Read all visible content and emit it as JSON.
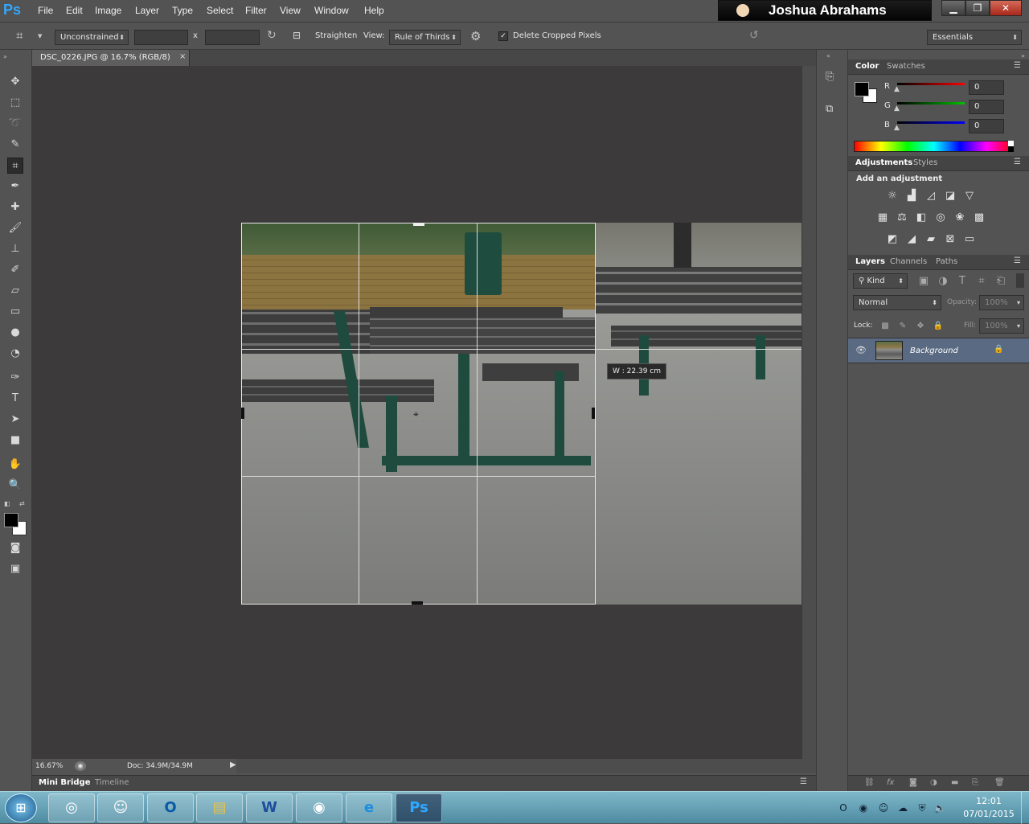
{
  "app": {
    "logo": "Ps"
  },
  "menu": [
    "File",
    "Edit",
    "Image",
    "Layer",
    "Type",
    "Select",
    "Filter",
    "View",
    "Window",
    "Help"
  ],
  "user": {
    "name": "Joshua Abrahams"
  },
  "window_controls": {
    "minimize": "▁",
    "restore": "❐",
    "close": "✕"
  },
  "options": {
    "ratio": "Unconstrained",
    "times": "x",
    "straighten": "Straighten",
    "view_label": "View:",
    "view_value": "Rule of Thirds",
    "delete_cropped": "Delete Cropped Pixels",
    "workspace": "Essentials"
  },
  "document": {
    "tab": "DSC_0226.JPG @ 16.7% (RGB/8)",
    "close": "×"
  },
  "crop_readout": "W :  22.39 cm",
  "status": {
    "zoom": "16.67%",
    "doc": "Doc: 34.9M/34.9M"
  },
  "bottom_tabs": [
    "Mini Bridge",
    "Timeline"
  ],
  "color_panel": {
    "tabs": [
      "Color",
      "Swatches"
    ],
    "channels": [
      {
        "label": "R",
        "value": "0",
        "color": "#ff0000"
      },
      {
        "label": "G",
        "value": "0",
        "color": "#00c000"
      },
      {
        "label": "B",
        "value": "0",
        "color": "#0000ff"
      }
    ]
  },
  "adjustments_panel": {
    "tabs": [
      "Adjustments",
      "Styles"
    ],
    "heading": "Add an adjustment"
  },
  "layers_panel": {
    "tabs": [
      "Layers",
      "Channels",
      "Paths"
    ],
    "filter": "Kind",
    "blend": "Normal",
    "opacity_label": "Opacity:",
    "opacity": "100%",
    "lock_label": "Lock:",
    "fill_label": "Fill:",
    "fill": "100%",
    "layer_name": "Background"
  },
  "clock": {
    "time": "12:01",
    "date": "07/01/2015"
  },
  "taskbar_apps": [
    "start",
    "chrome",
    "contacts",
    "outlook",
    "explorer",
    "word",
    "media",
    "ie",
    "photoshop"
  ]
}
